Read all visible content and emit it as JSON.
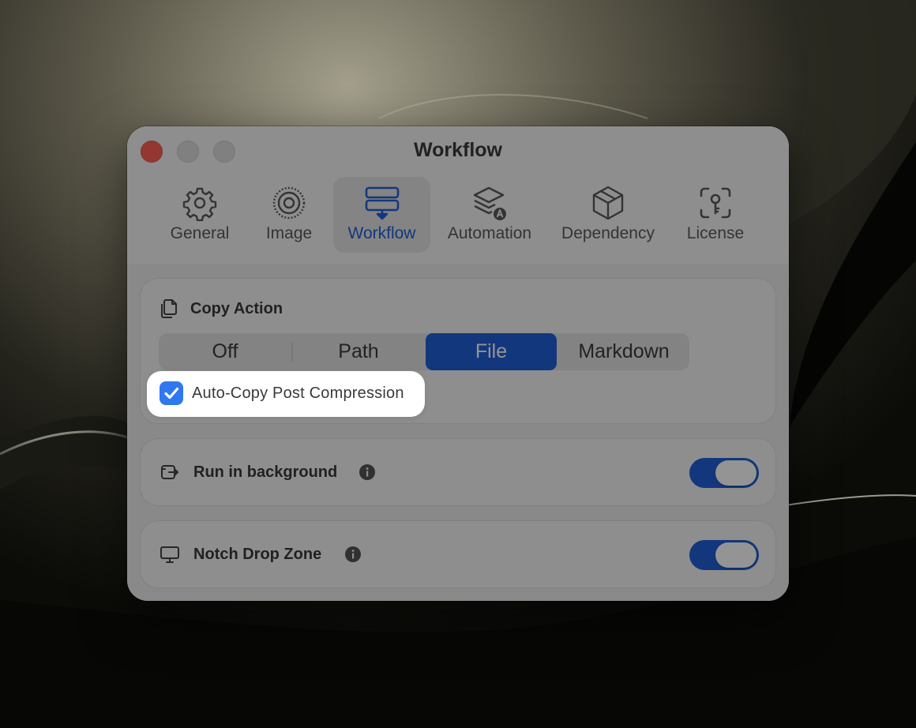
{
  "window": {
    "title": "Workflow"
  },
  "tabs": [
    {
      "label": "General",
      "icon": "gear-icon"
    },
    {
      "label": "Image",
      "icon": "image-target-icon"
    },
    {
      "label": "Workflow",
      "icon": "workflow-icon",
      "selected": true
    },
    {
      "label": "Automation",
      "icon": "layers-automation-icon"
    },
    {
      "label": "Dependency",
      "icon": "package-box-icon"
    },
    {
      "label": "License",
      "icon": "key-scan-icon"
    }
  ],
  "copy_action": {
    "title": "Copy Action",
    "icon": "copy-document-icon",
    "options": [
      "Off",
      "Path",
      "File",
      "Markdown"
    ],
    "selected": "File",
    "auto_copy": {
      "label": "Auto-Copy Post Compression",
      "checked": true
    }
  },
  "run_in_background": {
    "title": "Run in background",
    "icon": "background-window-icon",
    "enabled": true
  },
  "notch_drop_zone": {
    "title": "Notch Drop Zone",
    "icon": "display-monitor-icon",
    "enabled": true
  },
  "colors": {
    "accent": "#2160d6",
    "checkbox": "#2f78ef",
    "close_button": "#ff5f57"
  }
}
